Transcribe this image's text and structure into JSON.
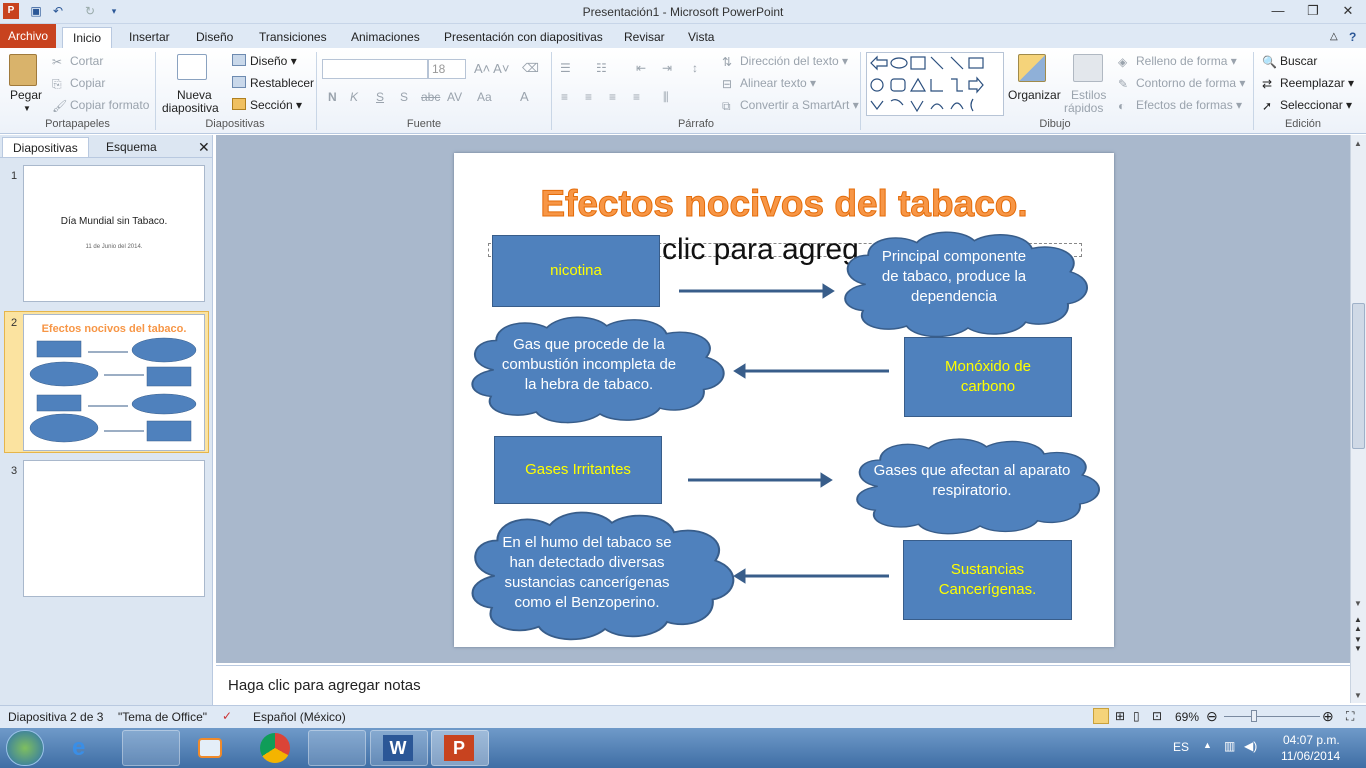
{
  "window": {
    "title": "Presentación1 - Microsoft PowerPoint",
    "min": "—",
    "max": "❐",
    "close": "✕"
  },
  "tabs": [
    "Archivo",
    "Inicio",
    "Insertar",
    "Diseño",
    "Transiciones",
    "Animaciones",
    "Presentación con diapositivas",
    "Revisar",
    "Vista"
  ],
  "ribbon": {
    "portapapeles": {
      "pegar": "Pegar",
      "cortar": "Cortar",
      "copiar": "Copiar",
      "copiar_formato": "Copiar formato",
      "label": "Portapapeles"
    },
    "diapositivas": {
      "nueva_line1": "Nueva",
      "nueva_line2": "diapositiva",
      "diseno": "Diseño",
      "restablecer": "Restablecer",
      "seccion": "Sección",
      "label": "Diapositivas"
    },
    "fuente": {
      "font_size": "18",
      "label": "Fuente"
    },
    "parrafo": {
      "direccion": "Dirección del texto",
      "alinear": "Alinear texto",
      "convertir": "Convertir a SmartArt",
      "label": "Párrafo"
    },
    "dibujo": {
      "organizar": "Organizar",
      "estilos_line1": "Estilos",
      "estilos_line2": "rápidos",
      "relleno": "Relleno de forma",
      "contorno": "Contorno de forma",
      "efectos": "Efectos de formas",
      "label": "Dibujo"
    },
    "edicion": {
      "buscar": "Buscar",
      "reemplazar": "Reemplazar",
      "seleccionar": "Seleccionar",
      "label": "Edición"
    }
  },
  "leftpane": {
    "tab_diapositivas": "Diapositivas",
    "tab_esquema": "Esquema",
    "slides": [
      {
        "num": "1",
        "title": "Día Mundial sin Tabaco.",
        "subtitle": "11 de Junio del 2014."
      },
      {
        "num": "2",
        "title": "Efectos nocivos del tabaco."
      },
      {
        "num": "3"
      }
    ]
  },
  "slide": {
    "title": "Efectos nocivos del tabaco.",
    "placeholder": "clic para agreg",
    "boxes": {
      "nicotina": "nicotina",
      "monoxido": "Monóxido de carbono",
      "gases": "Gases Irritantes",
      "sustancias": "Sustancias Cancerígenas."
    },
    "clouds": {
      "principal": "Principal componente de tabaco, produce la dependencia",
      "gas": "Gas que procede de la combustión incompleta de la hebra de tabaco.",
      "afectan": "Gases que afectan al aparato respiratorio.",
      "humo": "En el humo del tabaco se han detectado diversas sustancias cancerígenas  como el Benzoperino."
    }
  },
  "notes": "Haga clic para agregar notas",
  "status": {
    "slide_info": "Diapositiva 2 de 3",
    "theme": "\"Tema de Office\"",
    "language": "Español (México)",
    "zoom": "69%"
  },
  "taskbar": {
    "lang": "ES",
    "time": "04:07 p.m.",
    "date": "11/06/2014"
  },
  "colors": {
    "title_orange": "#f79646",
    "box_blue": "#4f81bd",
    "box_text_yellow": "#ffff00"
  }
}
